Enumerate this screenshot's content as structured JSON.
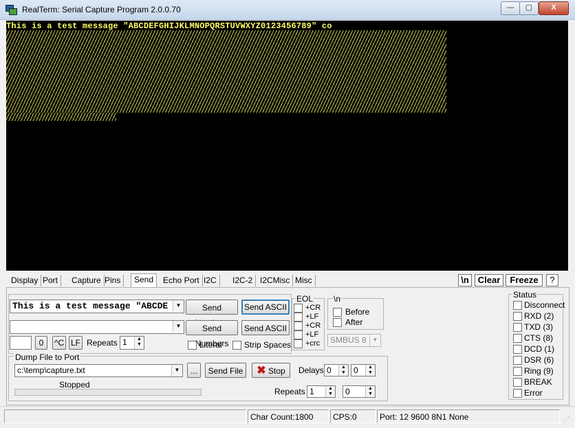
{
  "window": {
    "title": "RealTerm: Serial Capture Program 2.0.0.70",
    "min_glyph": "—",
    "max_glyph": "▢",
    "close_glyph": "X"
  },
  "terminal": {
    "first_line": "This is a test message \"ABCDEFGHIJKLMNOPQRSTUVWXYZ0123456789\" co",
    "text_color": "#ffff66",
    "bg_color": "#000000"
  },
  "tabs": [
    {
      "label": "Display"
    },
    {
      "label": "Port"
    },
    {
      "label": "Capture"
    },
    {
      "label": "Pins"
    },
    {
      "label": "Send",
      "active": true
    },
    {
      "label": "Echo Port"
    },
    {
      "label": "I2C"
    },
    {
      "label": "I2C-2"
    },
    {
      "label": "I2CMisc"
    },
    {
      "label": "Misc"
    }
  ],
  "toolbar": {
    "newline": "\\n",
    "clear": "Clear",
    "freeze": "Freeze",
    "help": "?"
  },
  "send": {
    "line1_value": "This is a test message \"ABCDE",
    "line2_value": "",
    "send_numbers_1": "Send Numbers",
    "send_ascii_1": "Send ASCII",
    "send_numbers_2": "Send Numbers",
    "send_ascii_2": "Send ASCII",
    "char_value": "",
    "zero_btn": "0",
    "ctrl_btn": "^C",
    "lf_btn": "LF",
    "repeats_label": "Repeats",
    "repeats_value": "1",
    "literal_label": "Literal",
    "strip_spaces_label": "Strip Spaces"
  },
  "eol": {
    "title": "EOL",
    "items": [
      "+CR",
      "+LF",
      "+CR",
      "+LF",
      "+crc"
    ]
  },
  "newline_group": {
    "title": "\\n",
    "before": "Before",
    "after": "After",
    "smbus": "SMBUS 8"
  },
  "dump": {
    "title": "Dump File to Port",
    "file_value": "c:\\temp\\capture.txt",
    "browse": "...",
    "send_file": "Send File",
    "stop": "Stop",
    "status": "Stopped",
    "delays_label": "Delays",
    "delay1": "0",
    "delay2": "0",
    "repeats_label": "Repeats",
    "repeats1": "1",
    "repeats2": "0"
  },
  "status_group": {
    "title": "Status",
    "items": [
      "Disconnect",
      "RXD (2)",
      "TXD (3)",
      "CTS (8)",
      "DCD (1)",
      "DSR (6)",
      "Ring (9)",
      "BREAK",
      "Error"
    ]
  },
  "statusbar": {
    "char_count": "Char Count:1800",
    "cps": "CPS:0",
    "port": "Port: 12 9600 8N1 None"
  }
}
